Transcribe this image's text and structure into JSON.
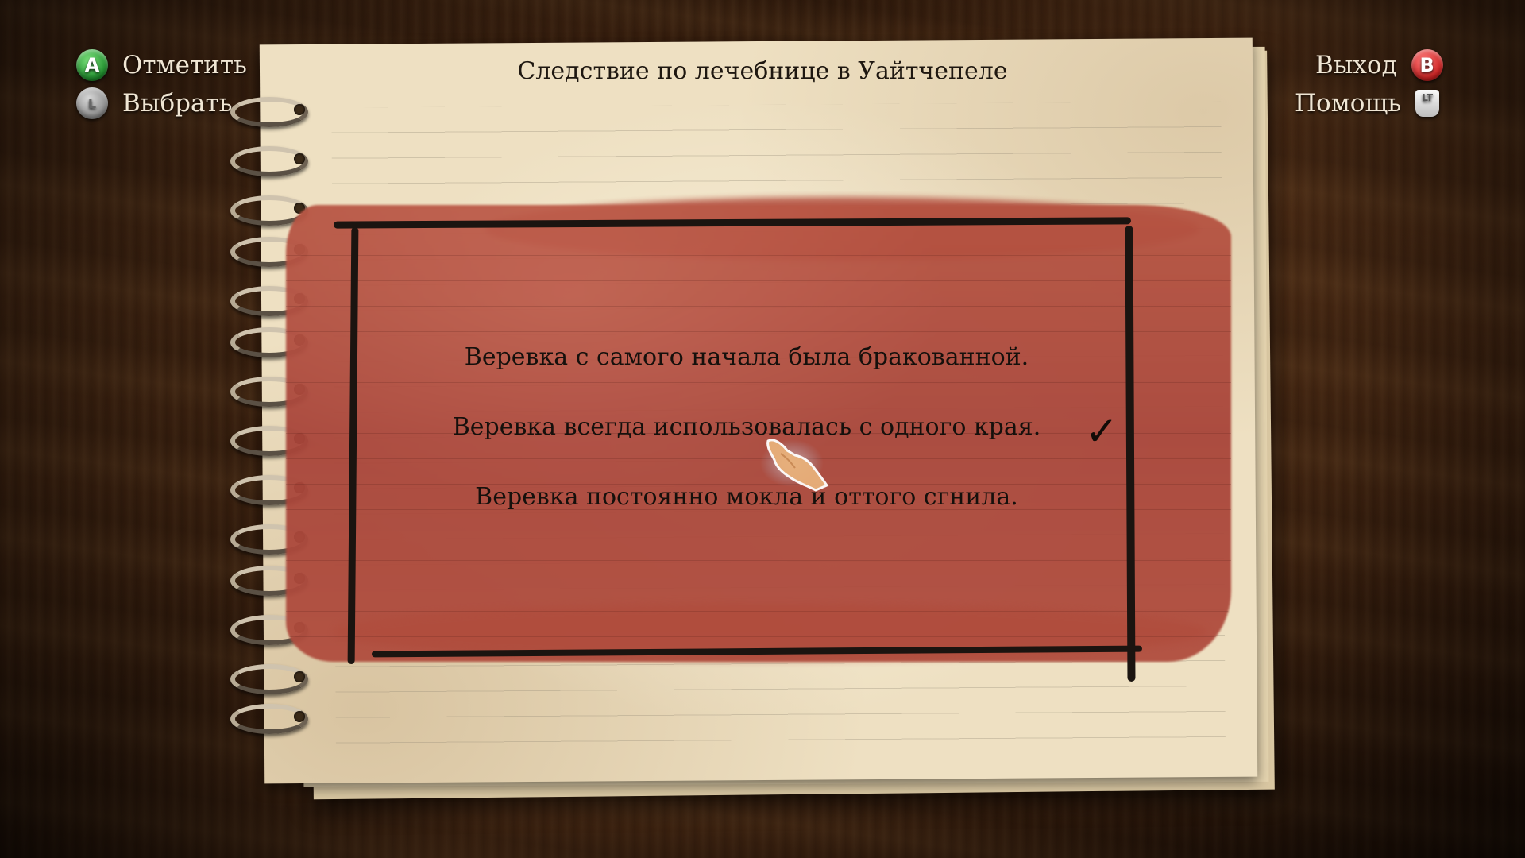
{
  "hud": {
    "mark_label": "Отметить",
    "mark_button": "A",
    "select_label": "Выбрать",
    "exit_label": "Выход",
    "exit_button": "B",
    "help_label": "Помощь",
    "help_button": "LT"
  },
  "notebook": {
    "title": "Следствие по лечебнице в Уайтчепеле",
    "options": [
      {
        "text": "Веревка с самого начала была бракованной.",
        "checked": false
      },
      {
        "text": "Веревка всегда использовалась с одного края.",
        "checked": true
      },
      {
        "text": "Веревка постоянно мокла и оттого сгнила.",
        "checked": false
      }
    ],
    "checkmark": "✓"
  },
  "colors": {
    "paint": "#b04d3e",
    "paper": "#eee0c2",
    "wood": "#3b200e"
  }
}
